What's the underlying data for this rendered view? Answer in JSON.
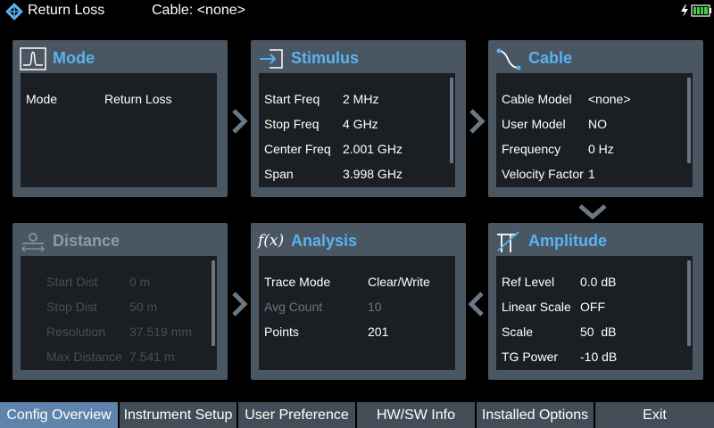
{
  "header": {
    "app_title": "Return Loss",
    "cable_label": "Cable: <none>",
    "logo_icon": "rs-diamond-logo-icon",
    "power_icon": "battery-charging-icon"
  },
  "panels": {
    "mode": {
      "title": "Mode",
      "icon": "pulse-icon",
      "rows": [
        {
          "label": "Mode",
          "value": "Return Loss"
        }
      ]
    },
    "stimulus": {
      "title": "Stimulus",
      "icon": "stimulus-arrow-icon",
      "rows": [
        {
          "label": "Start Freq",
          "value": "2 MHz"
        },
        {
          "label": "Stop Freq",
          "value": "4 GHz"
        },
        {
          "label": "Center Freq",
          "value": "2.001 GHz"
        },
        {
          "label": "Span",
          "value": "3.998 GHz"
        }
      ]
    },
    "cable": {
      "title": "Cable",
      "icon": "cable-curve-icon",
      "rows": [
        {
          "label": "Cable Model",
          "value": "<none>"
        },
        {
          "label": "User Model",
          "value": "NO"
        },
        {
          "label": "Frequency",
          "value": "0 Hz"
        },
        {
          "label": "Velocity Factor",
          "value": "1"
        }
      ]
    },
    "distance": {
      "title": "Distance",
      "icon": "distance-icon",
      "rows": [
        {
          "label": "Start Dist",
          "value": "0 m"
        },
        {
          "label": "Stop Dist",
          "value": "50 m"
        },
        {
          "label": "Resolution",
          "value": "37.519 mm"
        },
        {
          "label": "Max Distance",
          "value": "7.541 m"
        }
      ]
    },
    "analysis": {
      "title": "Analysis",
      "icon": "function-fx-icon",
      "icon_text": "f(x)",
      "rows": [
        {
          "label": "Trace Mode",
          "value": "Clear/Write"
        },
        {
          "label": "Avg Count",
          "value": "10"
        },
        {
          "label": "Points",
          "value": "201"
        }
      ]
    },
    "amplitude": {
      "title": "Amplitude",
      "icon": "amplitude-icon",
      "rows": [
        {
          "label": "Ref Level",
          "value": "0.0 dB"
        },
        {
          "label": "Linear Scale",
          "value": "OFF"
        },
        {
          "label": "Scale",
          "value": "50  dB"
        },
        {
          "label": "TG Power",
          "value": "-10 dB"
        }
      ]
    }
  },
  "softkeys": [
    {
      "label": "Config Overview"
    },
    {
      "label": "Instrument Setup"
    },
    {
      "label": "User Preference"
    },
    {
      "label": "HW/SW Info"
    },
    {
      "label": "Installed Options"
    },
    {
      "label": "Exit"
    }
  ],
  "colors": {
    "accent": "#58b4f0",
    "panel": "#4a5661",
    "panel_body": "#1b1f23",
    "softkey": "#434d57",
    "softkey_active": "#5e84ac",
    "battery": "#3cd23c"
  }
}
